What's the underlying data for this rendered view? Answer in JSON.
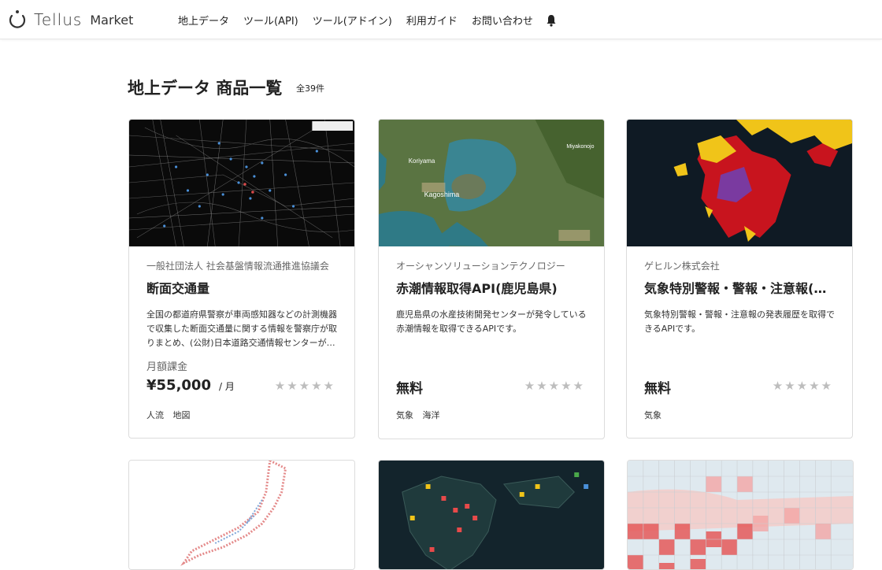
{
  "header": {
    "logo_text": "Tellus",
    "logo_sub": "Market",
    "nav": [
      "地上データ",
      "ツール(API)",
      "ツール(アドイン)",
      "利用ガイド",
      "お問い合わせ"
    ]
  },
  "page": {
    "title": "地上データ 商品一覧",
    "count": "全39件"
  },
  "cards": [
    {
      "provider": "一般社団法人 社会基盤情報流通推進協議会",
      "title": "断面交通量",
      "description": "全国の都道府県警察が車両感知器などの計測機器で収集した断面交通量に関する情報を警察庁が取りまとめ、(公財)日本道路交通情報センターが提供するデータです。",
      "billing": "月額課金",
      "price": "¥55,000",
      "per": "/ 月",
      "rating_stars": "★★★★★",
      "tags": [
        "人流",
        "地図"
      ]
    },
    {
      "provider": "オーシャンソリューションテクノロジー",
      "title": "赤潮情報取得API(鹿児島県)",
      "description": "鹿児島県の水産技術開発センターが発令している赤潮情報を取得できるAPIです。",
      "price_free": "無料",
      "rating_stars": "★★★★★",
      "tags": [
        "気象",
        "海洋"
      ]
    },
    {
      "provider": "ゲヒルン株式会社",
      "title": "気象特別警報・警報・注意報(アーカイブ)",
      "description": "気象特別警報・警報・注意報の発表履歴を取得できるAPIです。",
      "price_free": "無料",
      "rating_stars": "★★★★★",
      "tags": [
        "気象"
      ]
    }
  ],
  "map_labels": {
    "koriyama": "Koriyama",
    "kagoshima": "Kagoshima",
    "miyakonojo": "Miyakonojo"
  },
  "colors": {
    "accent_dark": "#222222",
    "border": "#dcdcdc",
    "star": "#bdbdbd"
  }
}
